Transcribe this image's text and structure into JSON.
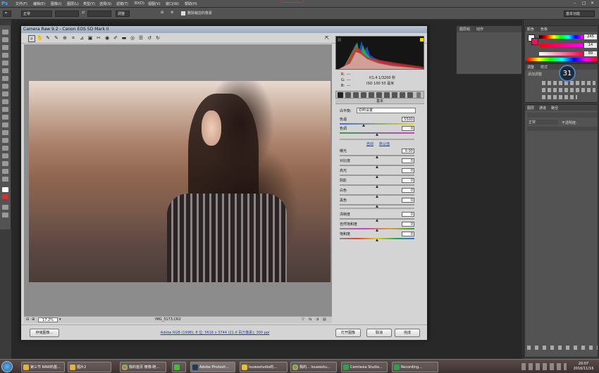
{
  "photoshop": {
    "logo": "Ps",
    "menus": [
      "文件(F)",
      "编辑(E)",
      "图像(I)",
      "图层(L)",
      "类型(Y)",
      "选择(S)",
      "滤镜(T)",
      "3D(D)",
      "视图(V)",
      "窗口(W)",
      "帮助(H)"
    ],
    "options": {
      "mode_value": "正常",
      "opacity_label": "调整",
      "refine_label": "删除裁剪的像素"
    },
    "workspace": "基本功能"
  },
  "camera_raw": {
    "title": "Camera Raw 9.2 - Canon EOS 5D Mark II",
    "zoom": "17.2%",
    "filename": "IMG_3173.CR2",
    "workflow_link": "Adobe RGB (1998); 8 位; 5616 x 3744 (21.0 百万像素); 300 ppi",
    "buttons": {
      "save": "存储图像...",
      "open": "打开图像",
      "cancel": "取消",
      "done": "完成"
    },
    "info": {
      "r": "R:",
      "g": "G:",
      "b": "B:",
      "dash": "---",
      "exposure_line1": "f/1.4   1/3200 秒",
      "exposure_line2": "ISO 100   50 毫米"
    },
    "panel_title": "基本",
    "white_balance": {
      "label": "白平衡:",
      "value": "原照设置"
    },
    "auto_link": "自动",
    "default_link": "默认值",
    "adjustments": [
      {
        "label": "色温",
        "value": "5500"
      },
      {
        "label": "色调",
        "value": "0"
      },
      {
        "label": "曝光",
        "value": "0.00"
      },
      {
        "label": "对比度",
        "value": "0"
      },
      {
        "label": "高光",
        "value": "0"
      },
      {
        "label": "阴影",
        "value": "0"
      },
      {
        "label": "白色",
        "value": "0"
      },
      {
        "label": "黑色",
        "value": "0"
      },
      {
        "label": "清晰度",
        "value": "0"
      },
      {
        "label": "自然饱和度",
        "value": "0"
      },
      {
        "label": "饱和度",
        "value": "0"
      }
    ]
  },
  "panels": {
    "color_tab": "颜色",
    "swatch_tab": "色板",
    "rgb": {
      "r": "245",
      "g": "14",
      "b": "89"
    },
    "adjust_tab": "调整",
    "styles_tab": "样式",
    "adjust_label": "添加调整",
    "dial_value": "31",
    "layers_tab": "图层",
    "channels_tab": "通道",
    "paths_tab": "路径",
    "layer_kind": "正常",
    "layer_opacity": "不透明度:",
    "mid_tabs": [
      "图层组",
      "动作"
    ]
  },
  "taskbar": {
    "items": [
      "第三节 RAW的基...",
      "图片2",
      "我的首页 微博-随...",
      "Adobe Photosh...",
      "louwestudio的...",
      "我的... louwestu...",
      "Camtasia Studio...",
      "Recording..."
    ],
    "clock_time": "20:07",
    "clock_date": "2016/11/16"
  },
  "colors": {
    "accent_blue": "#4fa6e8",
    "link_blue": "#1a3fb0",
    "chrome_gray": "#535353"
  }
}
